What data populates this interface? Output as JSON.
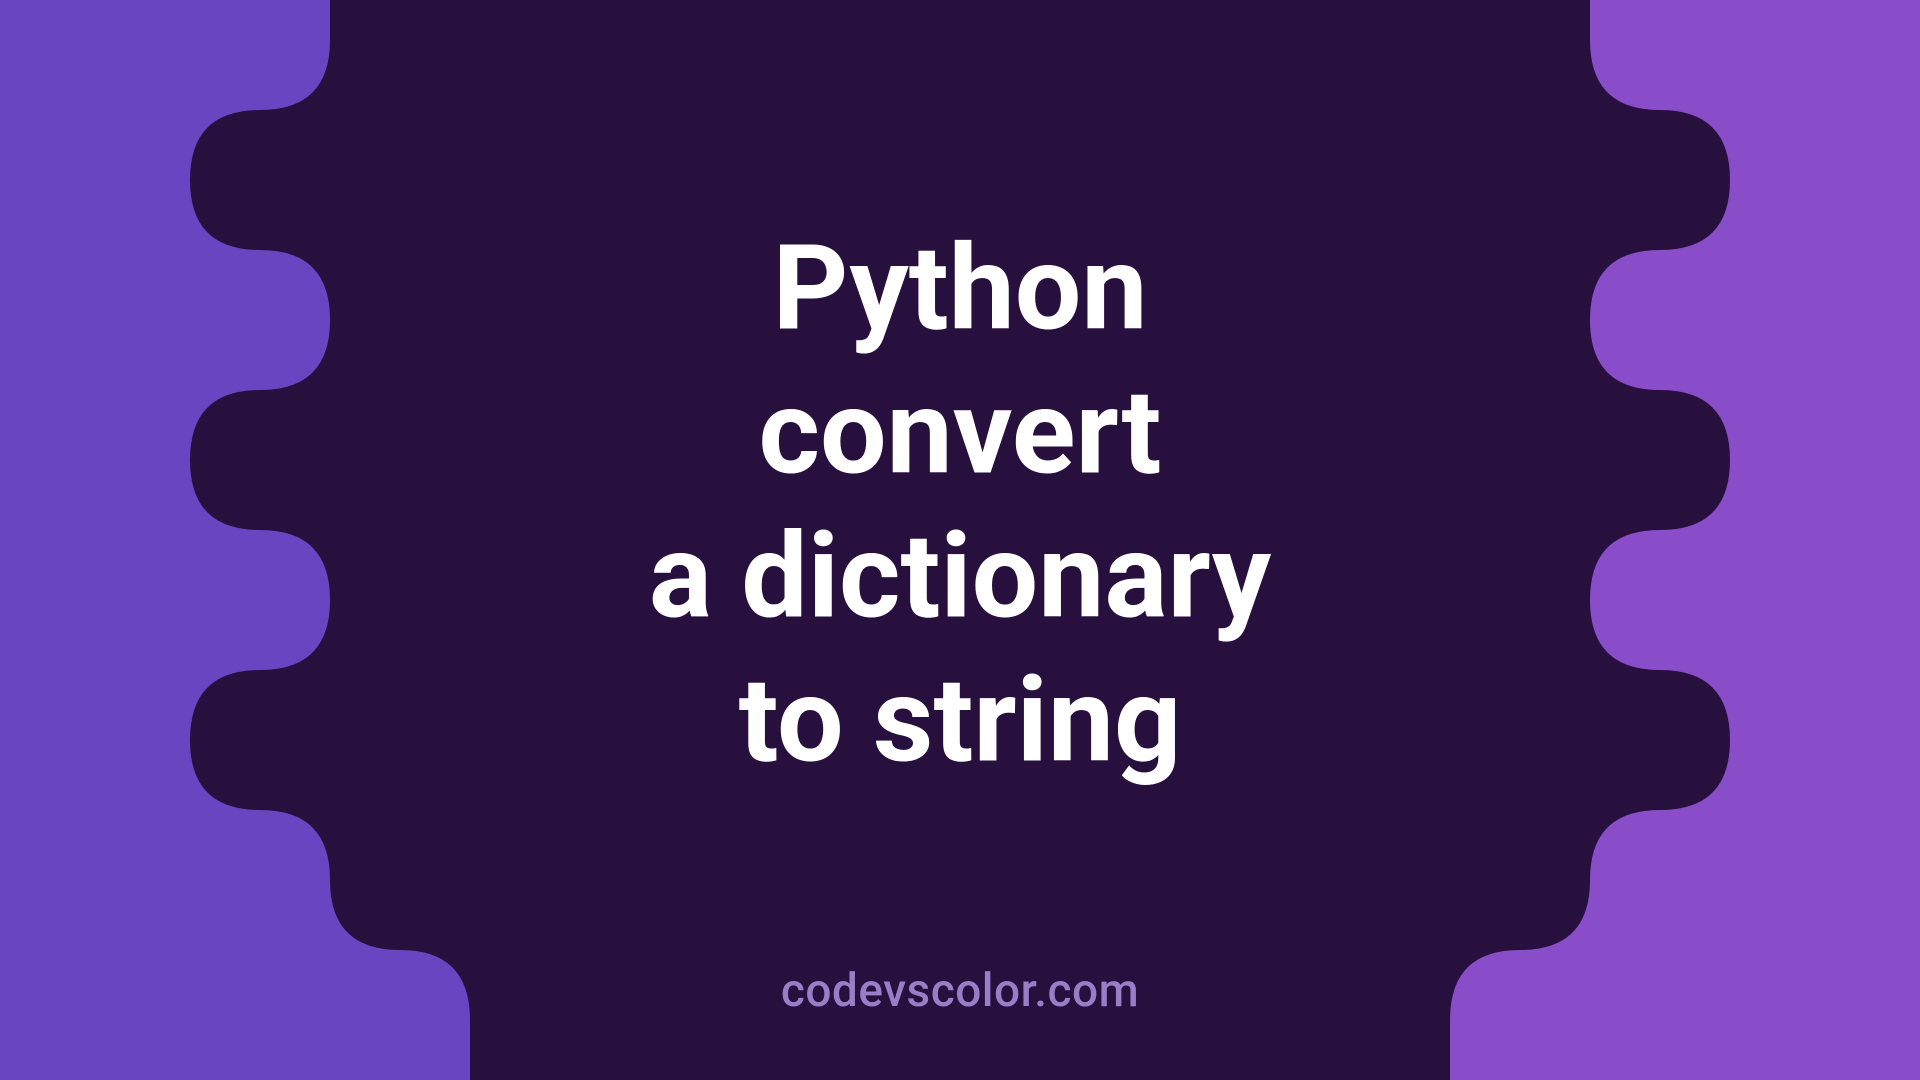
{
  "title_lines": "Python\nconvert\na dictionary\nto string",
  "watermark": "codevscolor.com",
  "colors": {
    "bg_left": "#6a45c2",
    "bg_right": "#8a4dc9",
    "blob": "#270f3e",
    "text": "#ffffff",
    "watermark": "#9a7dc7"
  }
}
